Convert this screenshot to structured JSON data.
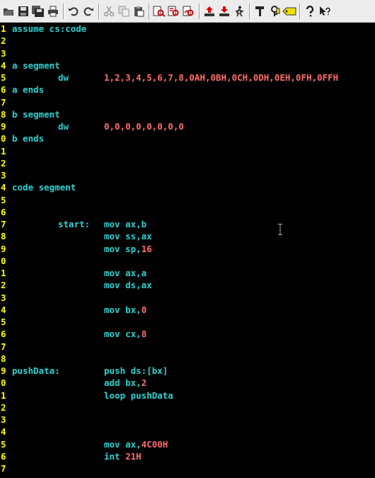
{
  "toolbar": {
    "icons": [
      "open-file-icon",
      "save-icon",
      "save-all-icon",
      "print-icon",
      "undo-icon",
      "redo-icon",
      "cut-icon",
      "copy-icon",
      "paste-icon",
      "find-icon",
      "find-next-icon",
      "replace-icon",
      "upload-icon",
      "download-icon",
      "run-icon",
      "hammer-icon",
      "key-icon",
      "tag-icon",
      "help-icon",
      "context-help-icon"
    ]
  },
  "colors": {
    "line_number": "#ffff00",
    "code_text": "#2fd0d0",
    "numeric_literal": "#ff6e6e",
    "background": "#000000"
  },
  "lines": [
    {
      "n": "1",
      "a": "assume cs:code",
      "b": "",
      "c": ""
    },
    {
      "n": "2",
      "a": "",
      "b": "",
      "c": ""
    },
    {
      "n": "3",
      "a": "",
      "b": "",
      "c": ""
    },
    {
      "n": "4",
      "a": "a segment",
      "b": "",
      "c": ""
    },
    {
      "n": "5",
      "a": "",
      "b": "dw",
      "c": "1,2,3,4,5,6,7,8,0AH,0BH,0CH,0DH,0EH,0FH,0FFH"
    },
    {
      "n": "6",
      "a": "a ends",
      "b": "",
      "c": ""
    },
    {
      "n": "7",
      "a": "",
      "b": "",
      "c": ""
    },
    {
      "n": "8",
      "a": "b segment",
      "b": "",
      "c": ""
    },
    {
      "n": "9",
      "a": "",
      "b": "dw",
      "c": "0,0,0,0,0,0,0,0"
    },
    {
      "n": "0",
      "a": "b ends",
      "b": "",
      "c": ""
    },
    {
      "n": "1",
      "a": "",
      "b": "",
      "c": ""
    },
    {
      "n": "2",
      "a": "",
      "b": "",
      "c": ""
    },
    {
      "n": "3",
      "a": "",
      "b": "",
      "c": ""
    },
    {
      "n": "4",
      "a": "code segment",
      "b": "",
      "c": ""
    },
    {
      "n": "5",
      "a": "",
      "b": "",
      "c": ""
    },
    {
      "n": "6",
      "a": "",
      "b": "",
      "c": ""
    },
    {
      "n": "7",
      "a": "",
      "b": "start:",
      "c": "mov ax,b"
    },
    {
      "n": "8",
      "a": "",
      "b": "",
      "c": "mov ss,ax"
    },
    {
      "n": "9",
      "a": "",
      "b": "",
      "c": "mov sp,",
      "d": "16"
    },
    {
      "n": "0",
      "a": "",
      "b": "",
      "c": ""
    },
    {
      "n": "1",
      "a": "",
      "b": "",
      "c": "mov ax,a"
    },
    {
      "n": "2",
      "a": "",
      "b": "",
      "c": "mov ds,ax"
    },
    {
      "n": "3",
      "a": "",
      "b": "",
      "c": ""
    },
    {
      "n": "4",
      "a": "",
      "b": "",
      "c": "mov bx,",
      "d": "0"
    },
    {
      "n": "5",
      "a": "",
      "b": "",
      "c": ""
    },
    {
      "n": "6",
      "a": "",
      "b": "",
      "c": "mov cx,",
      "d": "8"
    },
    {
      "n": "7",
      "a": "",
      "b": "",
      "c": ""
    },
    {
      "n": "8",
      "a": "",
      "b": "",
      "c": ""
    },
    {
      "n": "9",
      "a": "pushData:",
      "b": "",
      "c": "push ds:[bx]"
    },
    {
      "n": "0",
      "a": "",
      "b": "",
      "c": "add bx,",
      "d": "2"
    },
    {
      "n": "1",
      "a": "",
      "b": "",
      "c": "loop pushData"
    },
    {
      "n": "2",
      "a": "",
      "b": "",
      "c": ""
    },
    {
      "n": "3",
      "a": "",
      "b": "",
      "c": ""
    },
    {
      "n": "4",
      "a": "",
      "b": "",
      "c": ""
    },
    {
      "n": "5",
      "a": "",
      "b": "",
      "c": "mov ax,",
      "d": "4C00H"
    },
    {
      "n": "6",
      "a": "",
      "b": "",
      "c": "int ",
      "d": "21H"
    },
    {
      "n": "7",
      "a": "",
      "b": "",
      "c": ""
    }
  ]
}
